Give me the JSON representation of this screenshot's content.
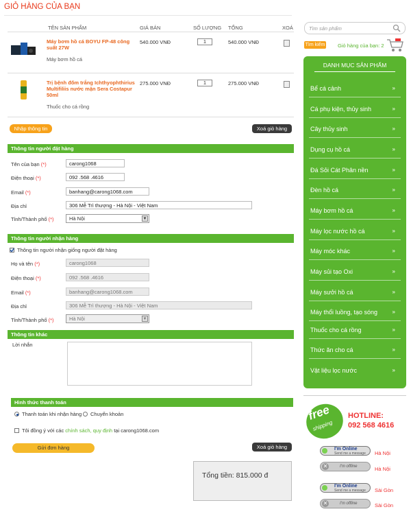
{
  "page_title": "GIỎ HÀNG CỦA BẠN",
  "cart": {
    "headers": [
      "TÊN SẢN PHẨM",
      "GIÁ BÁN",
      "SỐ LƯỢNG",
      "TỔNG",
      "XOÁ"
    ],
    "items": [
      {
        "name": "Máy bơm hồ cá BOYU FP-48 công suất 27W",
        "category": "Máy bơm hồ cá",
        "price": "540.000 VNĐ",
        "qty": "1",
        "total": "540.000 VNĐ"
      },
      {
        "name": "Trị bệnh đốm trắng Ichthyophthirius Multifiliis nước mặn Sera Costapur 50ml",
        "category": "Thuốc cho cá rồng",
        "price": "275.000 VNĐ",
        "qty": "1",
        "total": "275.000 VNĐ"
      }
    ],
    "enter_info_label": "Nhập thông tin",
    "clear_cart_label": "Xoá giỏ hàng"
  },
  "buyer": {
    "title": "Thông tin người đặt hàng",
    "name_label": "Tên của bạn",
    "name": "carong1068",
    "phone_label": "Điện thoại",
    "phone": "092 .568 .4616",
    "email_label": "Email",
    "email": "banhang@carong1068.com",
    "address_label": "Địa chỉ",
    "address": "306 Mễ Trì thượng - Hà Nội - Việt Nam",
    "city_label": "Tỉnh/Thành phố",
    "city": "Hà Nội"
  },
  "receiver": {
    "title": "Thông tin người nhận hàng",
    "same_label": "Thông tin người nhận giống người đặt hàng",
    "name_label": "Họ và tên",
    "name": "carong1068",
    "phone_label": "Điện thoại",
    "phone": "092 .568 .4616",
    "email_label": "Email",
    "email": "banhang@carong1068.com",
    "address_label": "Địa chỉ",
    "address": "306 Mễ Trì thượng - Hà Nội - Việt Nam",
    "city_label": "Tỉnh/Thành phố",
    "city": "Hà Nội"
  },
  "other": {
    "title": "Thông tin khác",
    "message_label": "Lời nhắn"
  },
  "payment": {
    "title": "Hình thức thanh toán",
    "option_cod": "Thanh toán khi nhận hàng",
    "option_transfer": "Chuyển khoản",
    "agree_prefix": "Tôi đồng ý với các",
    "agree_link": "chính sách, quy định",
    "agree_suffix": "tại carong1068.com",
    "submit_label": "Gửi đơn hàng",
    "clear_label": "Xoá giỏ hàng"
  },
  "total_text": "Tổng tiền: 815.000 đ",
  "sidebar": {
    "search_placeholder": "Tìm sản phẩm",
    "search_button": "Tìm kiếm",
    "cart_text": "Giỏ hàng của bạn: 2",
    "category_title": "DANH MỤC SẢN PHẨM",
    "categories": [
      "Bể cá cảnh",
      "Cá phụ kiện, thủy sinh",
      "Cây thủy sinh",
      "Dụng cụ hồ cá",
      "Đá Sỏi Cát Phân nền",
      "Đèn hồ cá",
      "Máy bơm hồ cá",
      "Máy lọc nước hồ cá",
      "Máy móc khác",
      "Máy sủi tạo Oxi",
      "Máy sưởi hồ cá",
      "Máy thổi luồng, tạo sóng",
      "Thuốc cho cá rồng",
      "Thức ăn cho cá",
      "Vật liệu lọc nước"
    ],
    "chevron": "»",
    "free_text": "free",
    "shipping_text": "shipping",
    "hotline_label": "HOTLINE:",
    "hotline_number": "092 568 4616",
    "online_text": "I'm Online",
    "online_sub": "Send me a message",
    "offline_text": "I'm offline",
    "loc_hanoi": "Hà Nội",
    "loc_saigon": "Sài Gòn"
  },
  "colors": {
    "accent": "#e8381a",
    "green": "#5ab52f",
    "orange": "#f7a21b"
  }
}
